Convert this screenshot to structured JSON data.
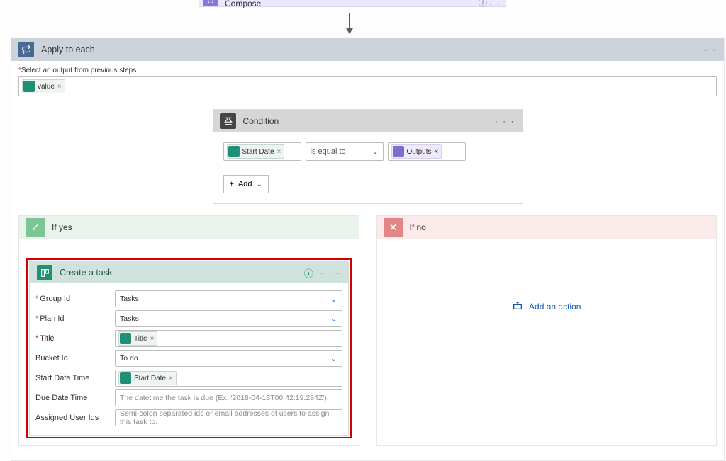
{
  "compose": {
    "label": "Compose"
  },
  "applyeach": {
    "title": "Apply to each",
    "select_output_label": "Select an output from previous steps",
    "token": {
      "label": "value"
    }
  },
  "condition": {
    "title": "Condition",
    "left_token": "Start Date",
    "operator": "is equal to",
    "right_token": "Outputs",
    "add_label": "Add"
  },
  "branches": {
    "yes": {
      "label": "If yes"
    },
    "no": {
      "label": "If no",
      "add_action": "Add an action"
    }
  },
  "task": {
    "title": "Create a task",
    "fields": {
      "group": {
        "label": "Group Id",
        "value": "Tasks"
      },
      "plan": {
        "label": "Plan Id",
        "value": "Tasks"
      },
      "title": {
        "label": "Title",
        "token": "Title"
      },
      "bucket": {
        "label": "Bucket Id",
        "value": "To do"
      },
      "start": {
        "label": "Start Date Time",
        "token": "Start Date"
      },
      "due": {
        "label": "Due Date Time",
        "placeholder": "The datetime the task is due (Ex. '2018-04-13T00:42:19.284Z')."
      },
      "assigned": {
        "label": "Assigned User Ids",
        "placeholder": "Semi-colon separated ids or email addresses of users to assign this task to."
      }
    }
  },
  "icons": {
    "x": "×",
    "plus": "+",
    "dots": "· · ·",
    "check": "✓",
    "xmark": "✕",
    "chev": "⌄",
    "help": "?"
  }
}
